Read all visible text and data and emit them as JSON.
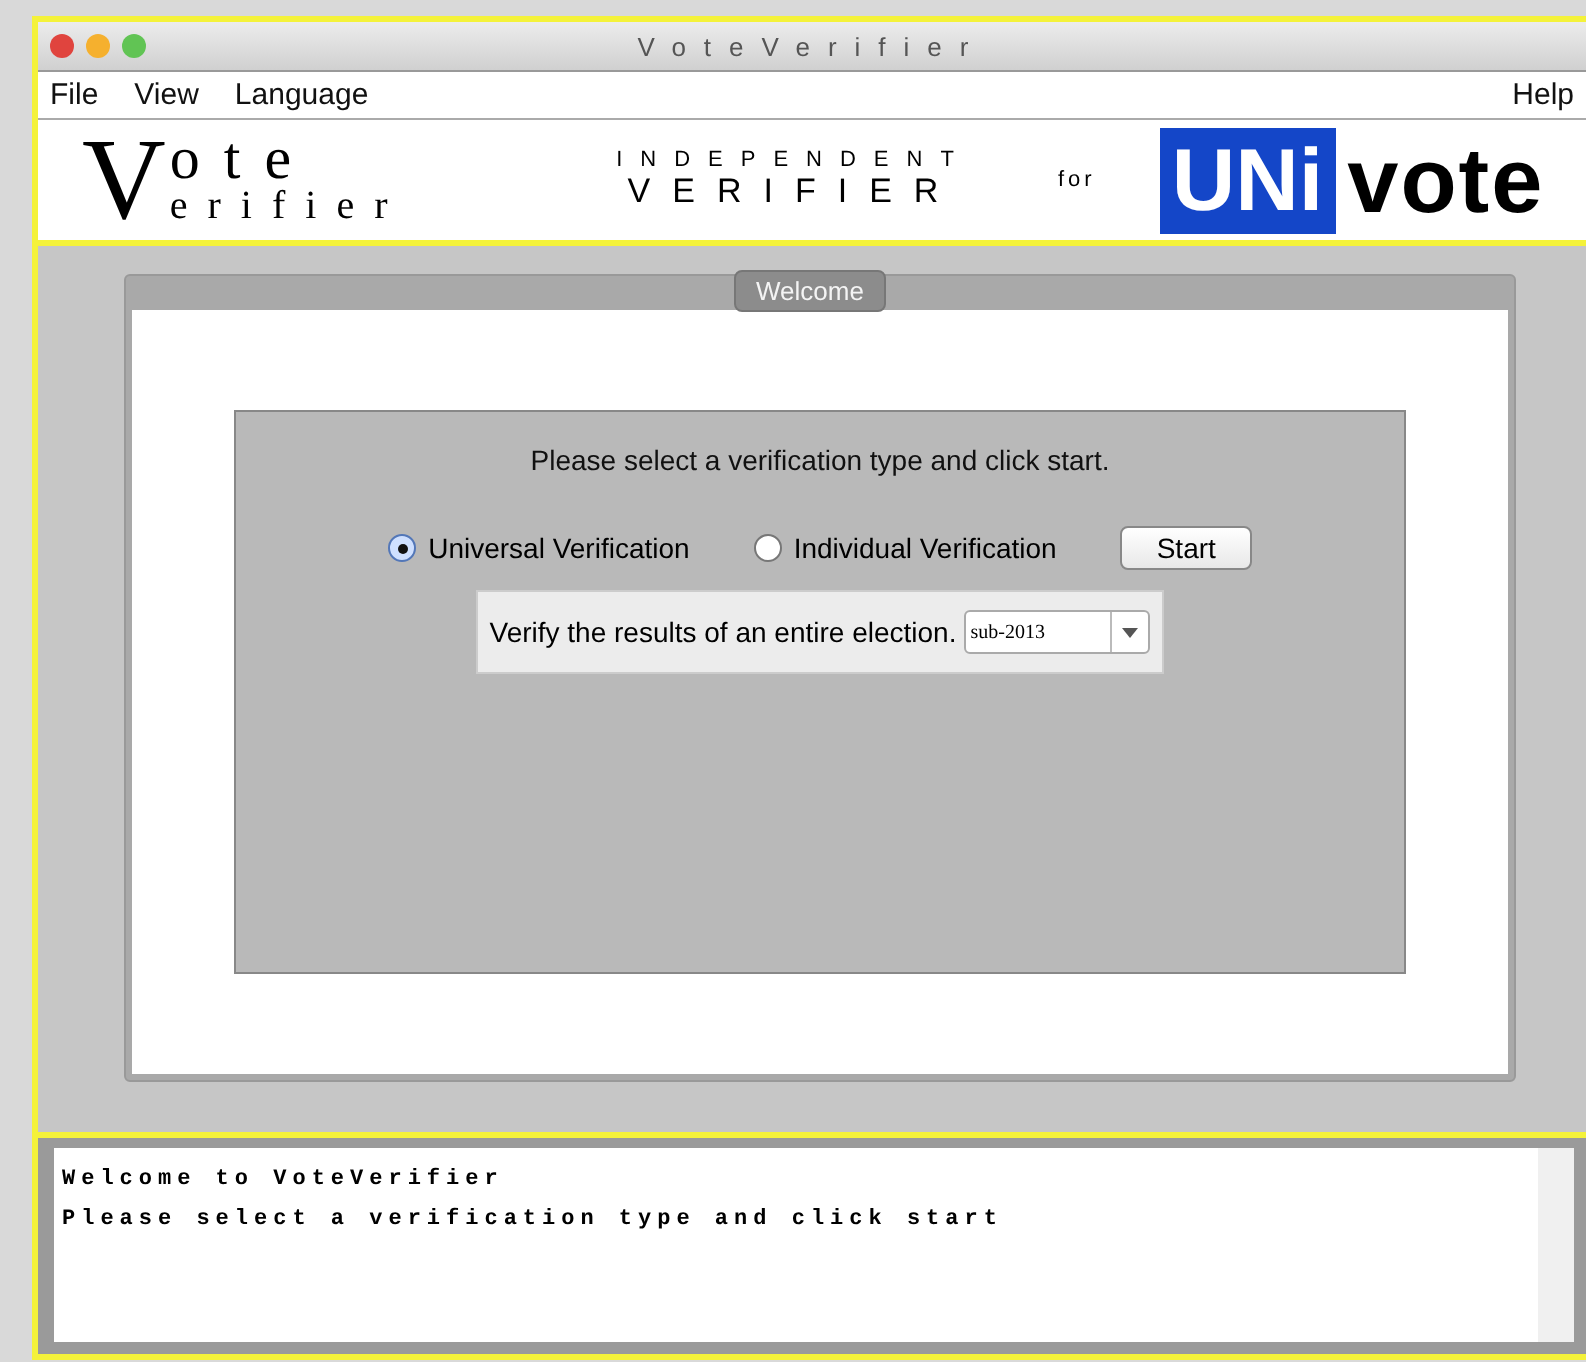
{
  "window": {
    "title": "VoteVerifier"
  },
  "menu": {
    "left": [
      "File",
      "View",
      "Language"
    ],
    "right": [
      "Help"
    ]
  },
  "banner": {
    "logo_initial": "V",
    "logo_top": "ote",
    "logo_bottom": "erifier",
    "subtitle_top": "INDEPENDENT",
    "subtitle_bottom": "VERIFIER",
    "connector": "for",
    "brand_box": "UNi",
    "brand_word": "vote"
  },
  "tab": {
    "label": "Welcome",
    "selected": true
  },
  "panel": {
    "instruction": "Please select a verification type and click start.",
    "options": [
      {
        "label": "Universal Verification",
        "selected": true
      },
      {
        "label": "Individual Verification",
        "selected": false
      }
    ],
    "start_button": "Start",
    "description": "Verify the results of an entire election.",
    "election_select": {
      "value": "sub-2013"
    }
  },
  "log": [
    "Welcome to VoteVerifier",
    "Please select a verification type and click start"
  ]
}
